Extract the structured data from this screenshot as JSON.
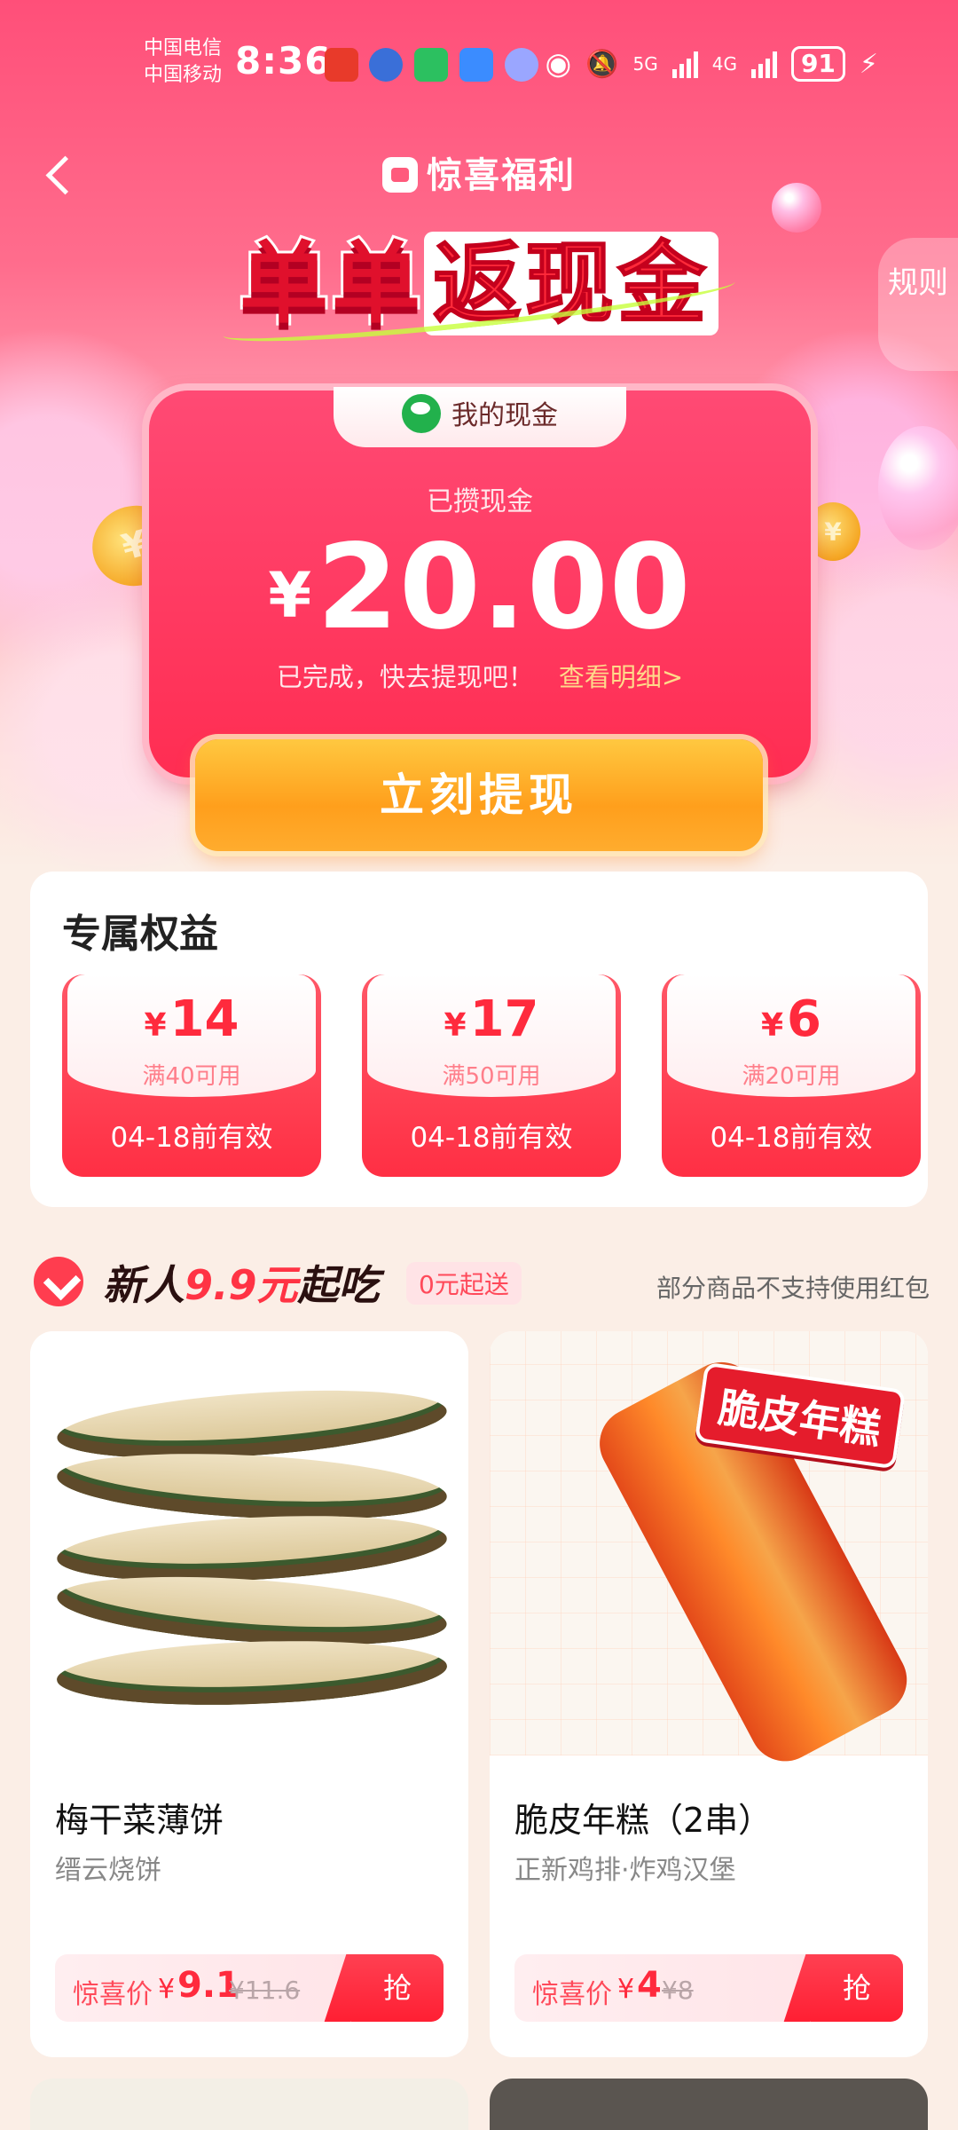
{
  "status_bar": {
    "carrier_1": "中国电信",
    "carrier_2": "中国移动",
    "time": "8:36",
    "net_1": "5G",
    "net_2": "4G",
    "battery": "91"
  },
  "header": {
    "brand": "惊喜福利",
    "headline_part1": "单单",
    "headline_part2": "返现金",
    "rules": "规则"
  },
  "cash": {
    "tag": "我的现金",
    "label": "已攒现金",
    "currency": "¥",
    "amount": "20.00",
    "status": "已完成，快去提现吧！",
    "detail_link": "查看明细>",
    "withdraw_button": "立刻提现"
  },
  "benefits": {
    "title": "专属权益",
    "coupons": [
      {
        "currency": "¥",
        "value": "14",
        "condition": "满40可用",
        "expiry": "04-18前有效"
      },
      {
        "currency": "¥",
        "value": "17",
        "condition": "满50可用",
        "expiry": "04-18前有效"
      },
      {
        "currency": "¥",
        "value": "6",
        "condition": "满20可用",
        "expiry": "04-18前有效"
      }
    ]
  },
  "newcomer": {
    "title_prefix": "新人",
    "title_highlight": "9.9元",
    "title_suffix": "起吃",
    "badge": "0元起送",
    "note": "部分商品不支持使用红包",
    "products": [
      {
        "name": "梅干菜薄饼",
        "shop": "缙云烧饼",
        "price_label": "惊喜价",
        "currency": "¥",
        "price": "9.1",
        "original_price": "¥11.6",
        "grab": "抢"
      },
      {
        "name": "脆皮年糕（2串）",
        "shop": "正新鸡排·炸鸡汉堡",
        "price_label": "惊喜价",
        "currency": "¥",
        "price": "4",
        "original_price": "¥8",
        "grab": "抢",
        "image_text": "脆皮年糕"
      }
    ]
  },
  "colors": {
    "accent_red": "#ff2d52",
    "button_orange": "#ff9f1c",
    "page_bg": "#fbeee6"
  }
}
